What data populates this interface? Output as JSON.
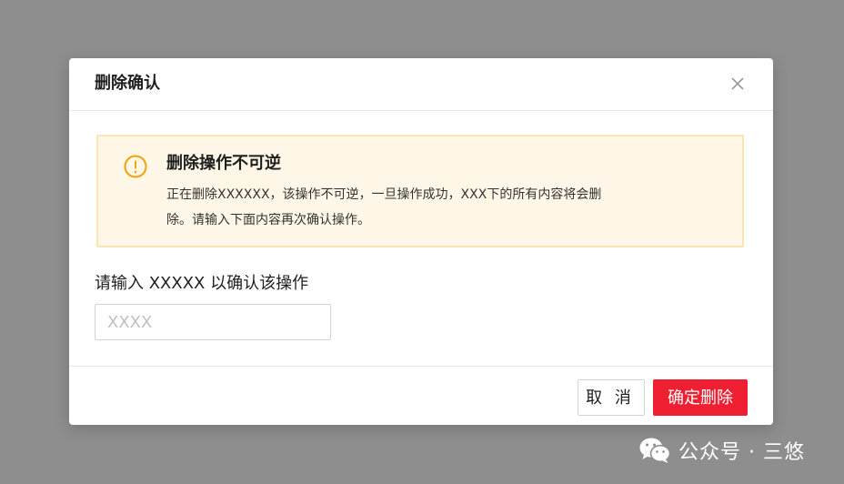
{
  "dialog": {
    "title": "删除确认",
    "close_icon": "close-icon",
    "alert": {
      "icon": "warning-circle-icon",
      "title": "删除操作不可逆",
      "body_line1": "正在删除XXXXXX，该操作不可逆，一旦操作成功，XXX下的所有内容将会删",
      "body_line2": "除。请输入下面内容再次确认操作。"
    },
    "confirm_label": "请输入 XXXXX 以确认该操作",
    "input": {
      "placeholder": "XXXX",
      "value": ""
    },
    "footer": {
      "cancel_label": "取 消",
      "confirm_label": "确定删除"
    }
  },
  "watermark": {
    "icon": "wechat-icon",
    "text": "公众号 · 三悠"
  },
  "colors": {
    "overlay": "#8e8e8f",
    "alert_bg": "#fef7e7",
    "alert_border": "#fae4b4",
    "warning": "#f2a10c",
    "danger": "#ee1f30"
  }
}
